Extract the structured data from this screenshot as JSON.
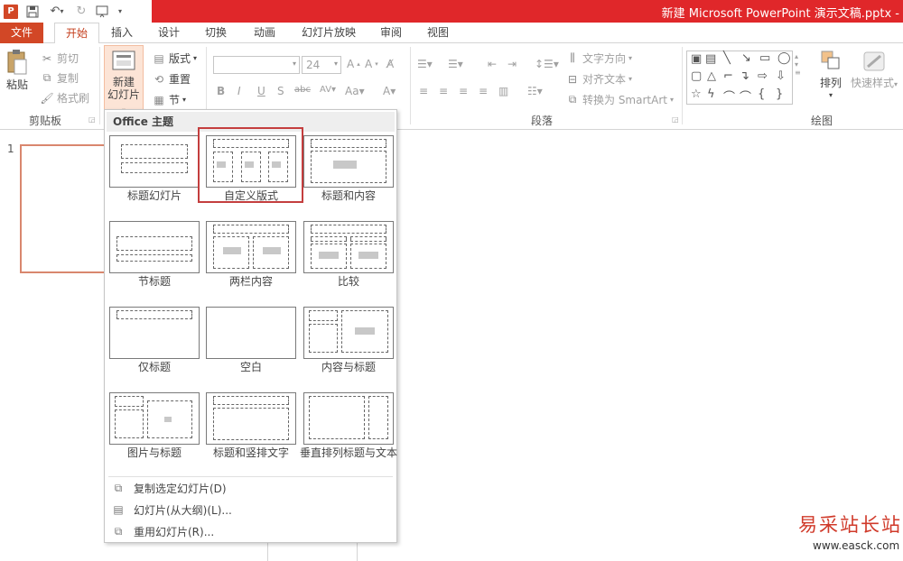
{
  "window": {
    "title": "新建 Microsoft PowerPoint 演示文稿.pptx -"
  },
  "qat": {
    "logo": "P"
  },
  "tabs": [
    "文件",
    "开始",
    "插入",
    "设计",
    "切换",
    "动画",
    "幻灯片放映",
    "审阅",
    "视图"
  ],
  "ribbon": {
    "clipboard": {
      "paste": "粘贴",
      "cut": "剪切",
      "copy": "复制",
      "format_painter": "格式刷",
      "label": "剪贴板"
    },
    "slides": {
      "new_slide_line1": "新建",
      "new_slide_line2": "幻灯片",
      "layout": "版式",
      "reset": "重置",
      "section": "节"
    },
    "font": {
      "size": "24"
    },
    "paragraph": {
      "text_direction": "文字方向",
      "align_text": "对齐文本",
      "smartart": "转换为 SmartArt",
      "label": "段落"
    },
    "drawing": {
      "arrange": "排列",
      "quick_styles": "快速样式",
      "label": "绘图"
    }
  },
  "layout_menu": {
    "header": "Office 主题",
    "layouts": [
      {
        "label": "标题幻灯片"
      },
      {
        "label": "自定义版式"
      },
      {
        "label": "标题和内容"
      },
      {
        "label": "节标题"
      },
      {
        "label": "两栏内容"
      },
      {
        "label": "比较"
      },
      {
        "label": "仅标题"
      },
      {
        "label": "空白"
      },
      {
        "label": "内容与标题"
      },
      {
        "label": "图片与标题"
      },
      {
        "label": "标题和竖排文字"
      },
      {
        "label": "垂直排列标题与文本"
      }
    ],
    "selected_index": 1,
    "actions": [
      "复制选定幻灯片(D)",
      "幻灯片(从大纲)(L)...",
      "重用幻灯片(R)..."
    ]
  },
  "slide_panel": {
    "slide_number": "1"
  },
  "watermark": {
    "line1": "易采站长站",
    "line2": "www.easck.com"
  },
  "colors": {
    "accent": "#d24726",
    "title_bar": "#e0272a",
    "selection": "#c43e3e"
  }
}
